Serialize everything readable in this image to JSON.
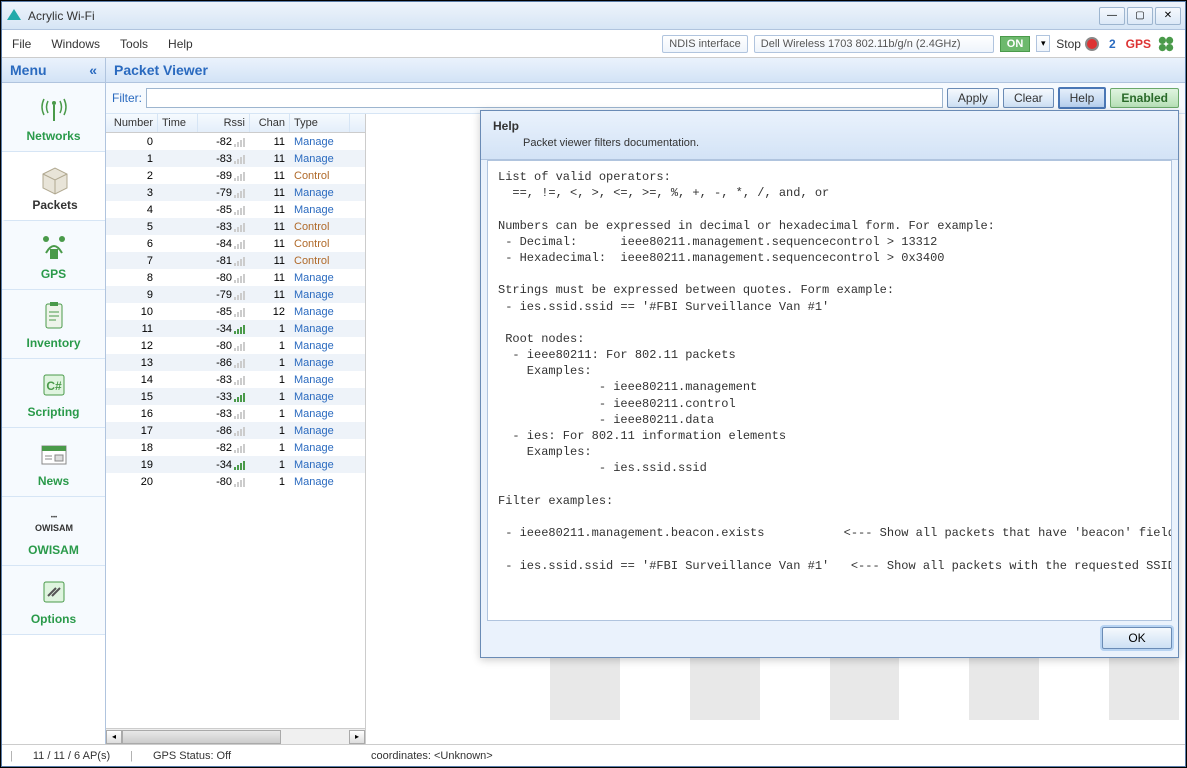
{
  "window": {
    "title": "Acrylic Wi-Fi"
  },
  "menubar": {
    "file": "File",
    "windows": "Windows",
    "tools": "Tools",
    "help": "Help"
  },
  "toolbar": {
    "iface_label": "NDIS interface",
    "iface_value": "Dell Wireless 1703 802.11b/g/n (2.4GHz)",
    "on": "ON",
    "stop": "Stop",
    "count": "2",
    "gps": "GPS"
  },
  "sidebar": {
    "header": "Menu",
    "items": [
      {
        "label": "Networks",
        "icon": "antenna"
      },
      {
        "label": "Packets",
        "icon": "box",
        "active": true
      },
      {
        "label": "GPS",
        "icon": "satellite"
      },
      {
        "label": "Inventory",
        "icon": "clipboard"
      },
      {
        "label": "Scripting",
        "icon": "csharp"
      },
      {
        "label": "News",
        "icon": "news"
      },
      {
        "label": "OWISAM",
        "icon": "owisam"
      },
      {
        "label": "Options",
        "icon": "wrench"
      }
    ]
  },
  "viewer": {
    "title": "Packet Viewer",
    "filter_label": "Filter:",
    "apply": "Apply",
    "clear": "Clear",
    "help": "Help",
    "enabled": "Enabled"
  },
  "table": {
    "headers": {
      "number": "Number",
      "time": "Time",
      "rssi": "Rssi",
      "chan": "Chan",
      "type": "Type"
    },
    "rows": [
      {
        "n": 0,
        "rssi": -82,
        "chan": 11,
        "type": "Manage",
        "sig": "low"
      },
      {
        "n": 1,
        "rssi": -83,
        "chan": 11,
        "type": "Manage",
        "sig": "low"
      },
      {
        "n": 2,
        "rssi": -89,
        "chan": 11,
        "type": "Control",
        "sig": "low"
      },
      {
        "n": 3,
        "rssi": -79,
        "chan": 11,
        "type": "Manage",
        "sig": "low"
      },
      {
        "n": 4,
        "rssi": -85,
        "chan": 11,
        "type": "Manage",
        "sig": "low"
      },
      {
        "n": 5,
        "rssi": -83,
        "chan": 11,
        "type": "Control",
        "sig": "low"
      },
      {
        "n": 6,
        "rssi": -84,
        "chan": 11,
        "type": "Control",
        "sig": "low"
      },
      {
        "n": 7,
        "rssi": -81,
        "chan": 11,
        "type": "Control",
        "sig": "low"
      },
      {
        "n": 8,
        "rssi": -80,
        "chan": 11,
        "type": "Manage",
        "sig": "low"
      },
      {
        "n": 9,
        "rssi": -79,
        "chan": 11,
        "type": "Manage",
        "sig": "low"
      },
      {
        "n": 10,
        "rssi": -85,
        "chan": 12,
        "type": "Manage",
        "sig": "low"
      },
      {
        "n": 11,
        "rssi": -34,
        "chan": 1,
        "type": "Manage",
        "sig": "high"
      },
      {
        "n": 12,
        "rssi": -80,
        "chan": 1,
        "type": "Manage",
        "sig": "low"
      },
      {
        "n": 13,
        "rssi": -86,
        "chan": 1,
        "type": "Manage",
        "sig": "low"
      },
      {
        "n": 14,
        "rssi": -83,
        "chan": 1,
        "type": "Manage",
        "sig": "low"
      },
      {
        "n": 15,
        "rssi": -33,
        "chan": 1,
        "type": "Manage",
        "sig": "high"
      },
      {
        "n": 16,
        "rssi": -83,
        "chan": 1,
        "type": "Manage",
        "sig": "low"
      },
      {
        "n": 17,
        "rssi": -86,
        "chan": 1,
        "type": "Manage",
        "sig": "low"
      },
      {
        "n": 18,
        "rssi": -82,
        "chan": 1,
        "type": "Manage",
        "sig": "low"
      },
      {
        "n": 19,
        "rssi": -34,
        "chan": 1,
        "type": "Manage",
        "sig": "high"
      },
      {
        "n": 20,
        "rssi": -80,
        "chan": 1,
        "type": "Manage",
        "sig": "low"
      }
    ]
  },
  "help_dialog": {
    "title": "Help",
    "subtitle": "Packet viewer filters documentation.",
    "body": "List of valid operators:\n  ==, !=, <, >, <=, >=, %, +, -, *, /, and, or\n\nNumbers can be expressed in decimal or hexadecimal form. For example:\n - Decimal:      ieee80211.management.sequencecontrol > 13312\n - Hexadecimal:  ieee80211.management.sequencecontrol > 0x3400\n\nStrings must be expressed between quotes. Form example:\n - ies.ssid.ssid == '#FBI Surveillance Van #1'\n\n Root nodes:\n  - ieee80211: For 802.11 packets\n    Examples:\n              - ieee80211.management\n              - ieee80211.control\n              - ieee80211.data\n  - ies: For 802.11 information elements\n    Examples:\n              - ies.ssid.ssid\n\nFilter examples:\n\n - ieee80211.management.beacon.exists           <--- Show all packets that have 'beacon' field\n\n - ies.ssid.ssid == '#FBI Surveillance Van #1'   <--- Show all packets with the requested SSID",
    "ok": "OK"
  },
  "statusbar": {
    "aps": "11 / 11 / 6 AP(s)",
    "gps": "GPS Status: Off",
    "coords": "coordinates: <Unknown>"
  }
}
